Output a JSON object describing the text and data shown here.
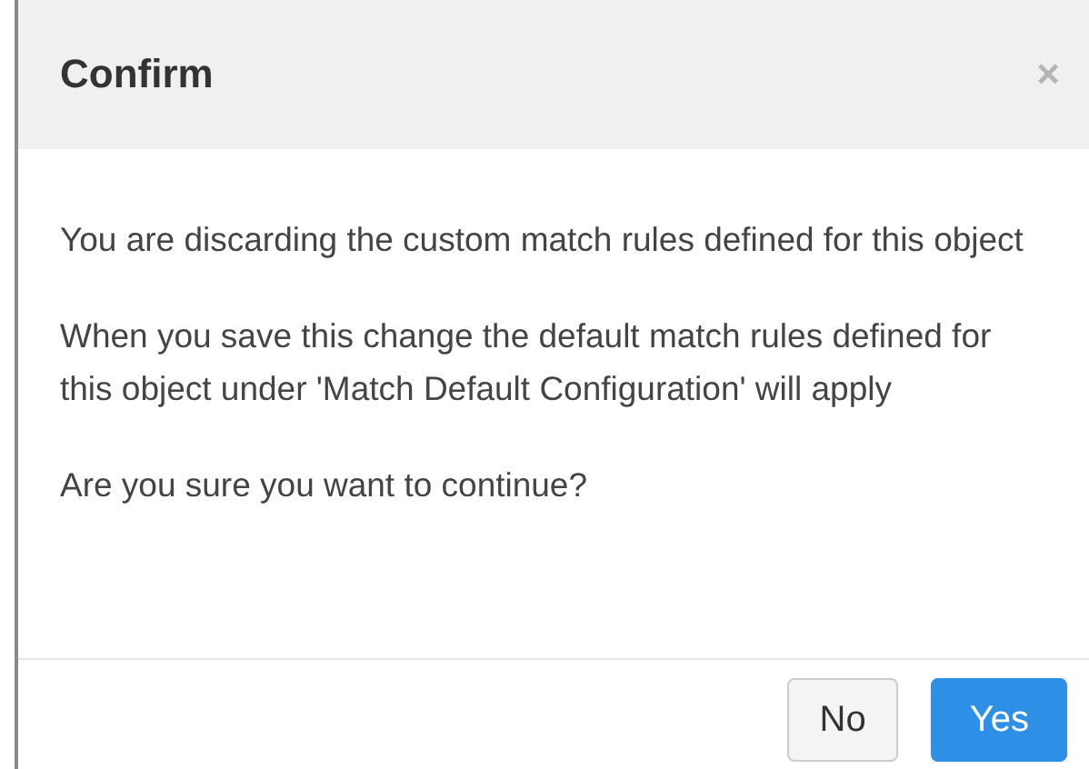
{
  "dialog": {
    "title": "Confirm",
    "close": "×",
    "paragraphs": [
      "You are discarding the custom match rules defined for this object",
      "When you save this change the default match rules defined for this object under 'Match Default Configuration' will apply",
      "Are you sure you want to continue?"
    ],
    "buttons": [
      {
        "label": "No",
        "kind": "secondary"
      },
      {
        "label": "Yes",
        "kind": "primary"
      }
    ]
  }
}
